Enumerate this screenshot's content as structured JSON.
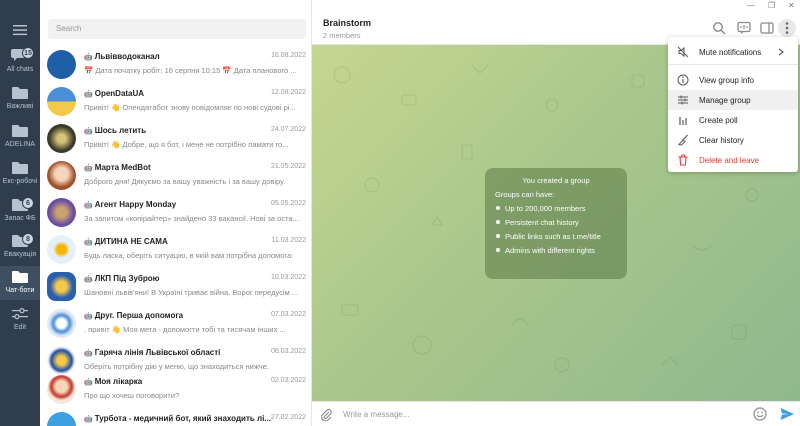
{
  "rail": {
    "folders": [
      {
        "label": "All chats",
        "badge": "15"
      },
      {
        "label": "Важливі",
        "badge": ""
      },
      {
        "label": "ADELINA",
        "badge": ""
      },
      {
        "label": "Екс-робочі",
        "badge": ""
      },
      {
        "label": "Запас ФБ",
        "badge": "6"
      },
      {
        "label": "Евакуація",
        "badge": "8"
      },
      {
        "label": "Чат-боти",
        "badge": ""
      },
      {
        "label": "Edit",
        "badge": ""
      }
    ]
  },
  "search": {
    "placeholder": "Search"
  },
  "chats": [
    {
      "name": "Львівводоканал",
      "date": "16.08.2022",
      "preview": "📅 Дата початку робіт: 16 серпня 10:15 📅 Дата планового ...",
      "color": "#1f5fa8"
    },
    {
      "name": "OpenDataUA",
      "date": "12.08.2022",
      "preview": "Привіт! 👋 Опендатабот знову повідомляє по нові судові рі...",
      "color": "#f4c94a"
    },
    {
      "name": "Шось летить",
      "date": "24.07.2022",
      "preview": "Привіт! 👋 Добре, що я бот, і мене не потрібно ламати го...",
      "color": "#3a3a2a"
    },
    {
      "name": "Марта MedBot",
      "date": "21.05.2022",
      "preview": "Доброго дня! Дякуємо за вашу уважність і за вашу довіру.",
      "color": "#f28c8c"
    },
    {
      "name": "Агент Happy Monday",
      "date": "05.05.2022",
      "preview": "За запитом «копірайтер» знайдено 33 вакансії.  Нові за оста...",
      "color": "#6a4fa0"
    },
    {
      "name": "ДИТИНА НЕ САМА",
      "date": "11.03.2022",
      "preview": "Будь ласка, оберіть ситуацію, в якій вам потрібна допомога:",
      "color": "#e6f0fa"
    },
    {
      "name": "ЛКП Під Зуброю",
      "date": "10.03.2022",
      "preview": "Шановні львів'яни!  В Україні триває війна. Ворог передусім ...",
      "color": "#2a5fb0"
    },
    {
      "name": "Друг. Перша допомога",
      "date": "07.03.2022",
      "preview": ". привіт 👋 Моя мета - допомогти тобі та тисячам інших ...",
      "color": "#dfe9f5"
    },
    {
      "name": "Гаряча лінія Львівської області",
      "date": "06.03.2022",
      "preview": "Оберіть потрібну дію у меню, що знаходиться нижче.",
      "color": "#1d4fa3"
    },
    {
      "name": "Моя лікарка",
      "date": "02.03.2022",
      "preview": "Про що хочеш поговорити?",
      "color": "#f5e6dc"
    },
    {
      "name": "Турбота - медичний бот, який знаходить лі...",
      "date": "27.02.2022",
      "preview": "",
      "color": "#3aa0e0"
    }
  ],
  "main": {
    "title": "Brainstorm",
    "subtitle": "2 members",
    "service": {
      "title": "You created a group",
      "heading": "Groups can have:",
      "items": [
        "Up to 200,000 members",
        "Persistent chat history",
        "Public links such as t.me/title",
        "Admins with different rights"
      ]
    },
    "composer_placeholder": "Write a message..."
  },
  "menu": {
    "items": [
      {
        "label": "Mute notifications",
        "icon": "mute-icon"
      },
      {
        "label": "View group info",
        "icon": "info-icon"
      },
      {
        "label": "Manage group",
        "icon": "sliders-icon"
      },
      {
        "label": "Create poll",
        "icon": "poll-icon"
      },
      {
        "label": "Clear history",
        "icon": "broom-icon"
      },
      {
        "label": "Delete and leave",
        "icon": "trash-icon"
      }
    ]
  },
  "window": {
    "minimize": "—",
    "restore": "❐",
    "close": "✕"
  }
}
